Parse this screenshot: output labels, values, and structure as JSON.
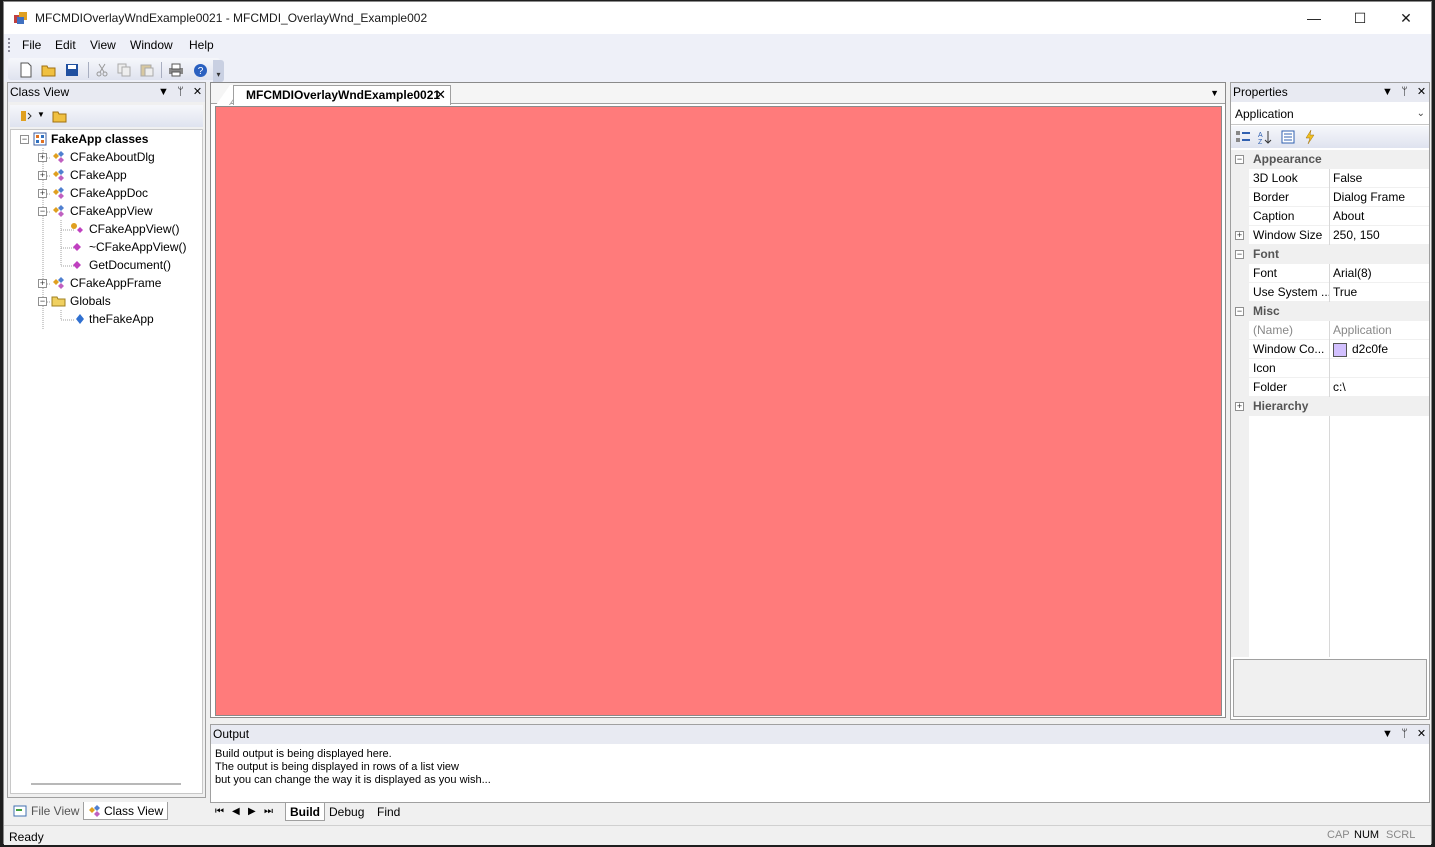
{
  "window": {
    "title": "MFCMDIOverlayWndExample0021 - MFCMDI_OverlayWnd_Example002",
    "controls": {
      "minimize": "—",
      "maximize": "☐",
      "close": "✕"
    }
  },
  "menu": [
    "File",
    "Edit",
    "View",
    "Window",
    "Help"
  ],
  "class_view": {
    "title": "Class View",
    "tree": [
      {
        "label": "FakeApp classes",
        "bold": true
      },
      {
        "label": "CFakeAboutDlg"
      },
      {
        "label": "CFakeApp"
      },
      {
        "label": "CFakeAppDoc"
      },
      {
        "label": "CFakeAppView"
      },
      {
        "label": "CFakeAppView()"
      },
      {
        "label": "~CFakeAppView()"
      },
      {
        "label": "GetDocument()"
      },
      {
        "label": "CFakeAppFrame"
      },
      {
        "label": "Globals"
      },
      {
        "label": "theFakeApp"
      }
    ],
    "bottom_tabs": [
      "File View",
      "Class View"
    ]
  },
  "document": {
    "tab_title": "MFCMDIOverlayWndExample0021",
    "close": "✕",
    "canvas_color": "#ff7b7b"
  },
  "properties": {
    "title": "Properties",
    "object": "Application",
    "categories": {
      "appearance": "Appearance",
      "font": "Font",
      "misc": "Misc",
      "hierarchy": "Hierarchy"
    },
    "rows": {
      "look3d": {
        "name": "3D Look",
        "value": "False"
      },
      "border": {
        "name": "Border",
        "value": "Dialog Frame"
      },
      "caption": {
        "name": "Caption",
        "value": "About"
      },
      "window_size": {
        "name": "Window Size",
        "value": "250, 150"
      },
      "font": {
        "name": "Font",
        "value": "Arial(8)"
      },
      "use_system": {
        "name": "Use System ...",
        "value": "True"
      },
      "name": {
        "name": "(Name)",
        "value": "Application"
      },
      "window_color": {
        "name": "Window Co...",
        "value": "d2c0fe",
        "swatch": "#d2c0fe"
      },
      "icon": {
        "name": "Icon",
        "value": ""
      },
      "folder": {
        "name": "Folder",
        "value": "c:\\"
      }
    }
  },
  "output": {
    "title": "Output",
    "lines": [
      "Build output is being displayed here.",
      "The output is being displayed in rows of a list view",
      "but you can change the way it is displayed as you wish..."
    ],
    "tabs": [
      "Build",
      "Debug",
      "Find"
    ]
  },
  "status": {
    "text": "Ready",
    "indicators": [
      "CAP",
      "NUM",
      "SCRL"
    ]
  }
}
